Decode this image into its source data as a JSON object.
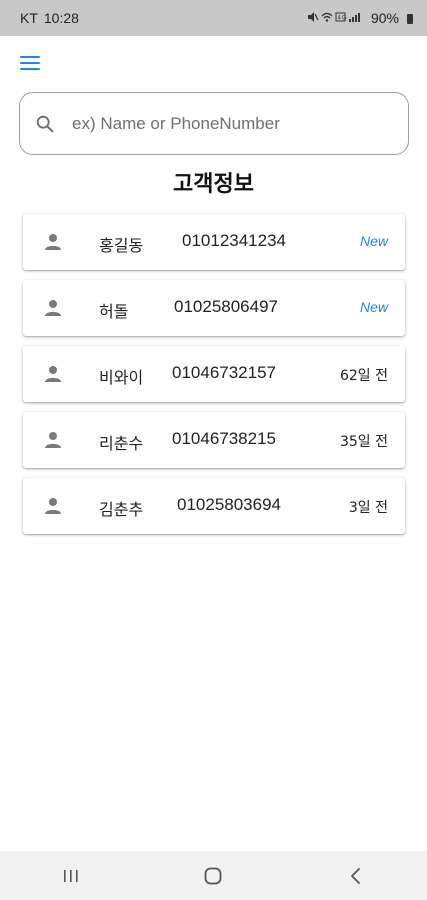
{
  "status_bar": {
    "carrier": "KT",
    "time": "10:28",
    "battery": "90%",
    "icons": [
      "mute-icon",
      "wifi-icon",
      "lte-icon",
      "signal-icon",
      "battery-icon"
    ]
  },
  "header": {
    "menu_icon": "hamburger-menu-icon"
  },
  "search": {
    "placeholder": "ex) Name or PhoneNumber",
    "value": ""
  },
  "page": {
    "title": "고객정보"
  },
  "customers": [
    {
      "name": "홍길동",
      "phone": "01012341234",
      "badge": "New",
      "badge_type": "new"
    },
    {
      "name": "허돌",
      "phone": "01025806497",
      "badge": "New",
      "badge_type": "new"
    },
    {
      "name": "비와이",
      "phone": "01046732157",
      "badge": "62일 전",
      "badge_type": "ago"
    },
    {
      "name": "리춘수",
      "phone": "01046738215",
      "badge": "35일 전",
      "badge_type": "ago"
    },
    {
      "name": "김춘추",
      "phone": "01025803694",
      "badge": "3일 전",
      "badge_type": "ago"
    }
  ],
  "navigation": {
    "buttons": [
      "recent-apps-icon",
      "home-icon",
      "back-icon"
    ]
  },
  "colors": {
    "accent": "#1e88e5",
    "status_bar": "#c8c8c8",
    "nav_bar": "#f2f2f2"
  }
}
